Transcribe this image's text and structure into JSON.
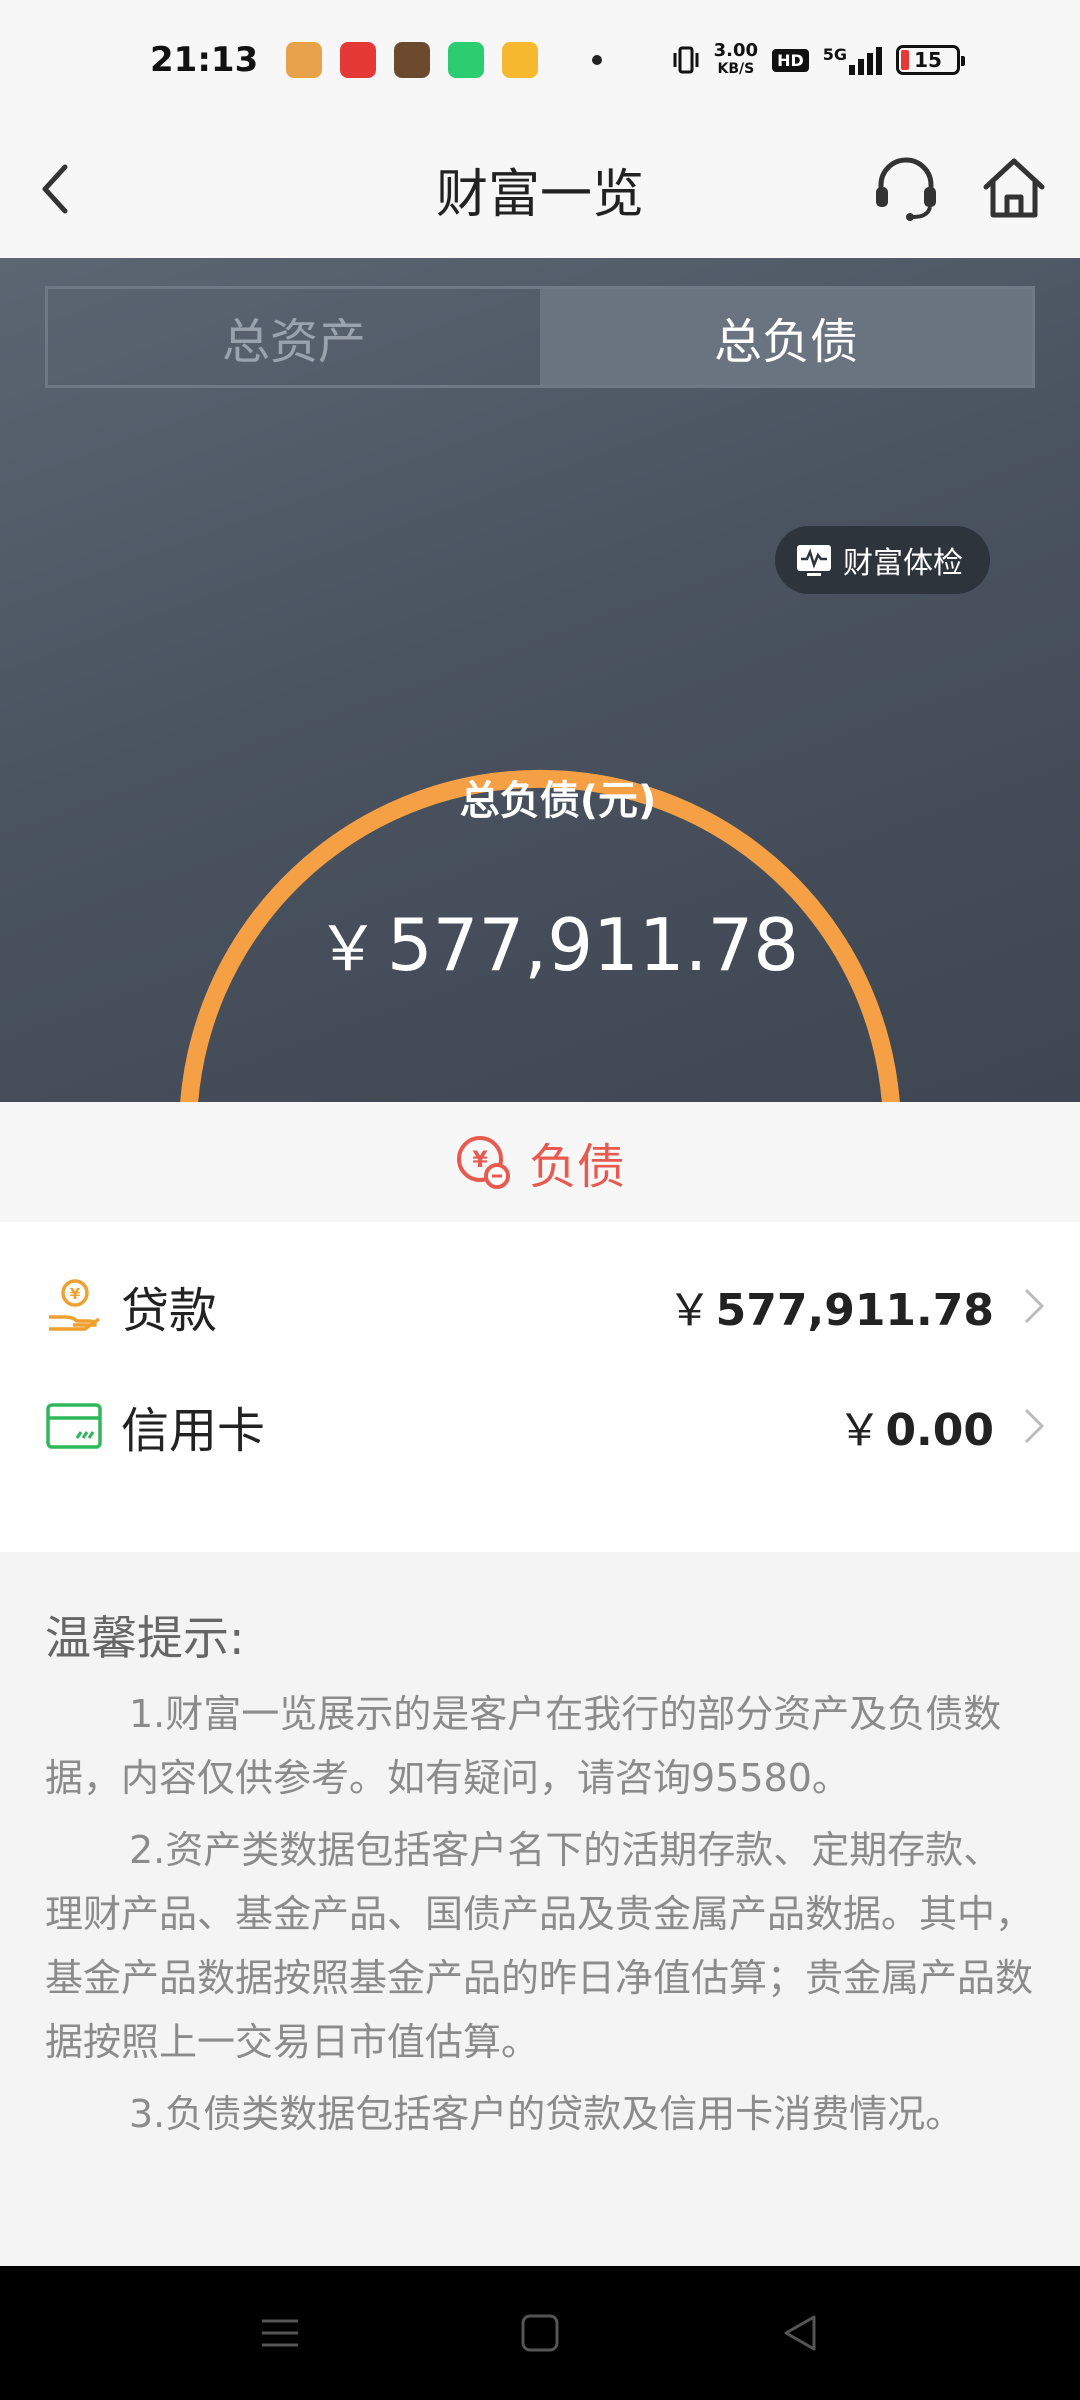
{
  "status_bar": {
    "time": "21:13",
    "net_speed_value": "3.00",
    "net_speed_unit": "KB/S",
    "hd_label": "HD",
    "network_label": "5G",
    "battery_level": "15"
  },
  "header": {
    "title": "财富一览"
  },
  "tabs": {
    "assets": "总资产",
    "liabilities": "总负债",
    "active": "liabilities"
  },
  "hero": {
    "checkup_label": "财富体检",
    "total_label": "总负债(元)",
    "currency_symbol": "￥",
    "total_amount": "577,911.78",
    "gauge_color": "#f6a045"
  },
  "section": {
    "title": "负债"
  },
  "liabilities": [
    {
      "icon": "loan-hand-coin-icon",
      "label": "贷款",
      "currency": "￥",
      "amount": "577,911.78"
    },
    {
      "icon": "credit-card-icon",
      "label": "信用卡",
      "currency": "￥",
      "amount": "0.00"
    }
  ],
  "tips": {
    "title": "温馨提示:",
    "items": [
      "1.财富一览展示的是客户在我行的部分资产及负债数据，内容仅供参考。如有疑问，请咨询95580。",
      "2.资产类数据包括客户名下的活期存款、定期存款、理财产品、基金产品、国债产品及贵金属产品数据。其中，基金产品数据按照基金产品的昨日净值估算；贵金属产品数据按照上一交易日市值估算。",
      "3.负债类数据包括客户的贷款及信用卡消费情况。"
    ]
  },
  "colors": {
    "accent_red": "#e85a4f",
    "loan_icon": "#f0a030",
    "card_icon": "#2fb85a"
  }
}
